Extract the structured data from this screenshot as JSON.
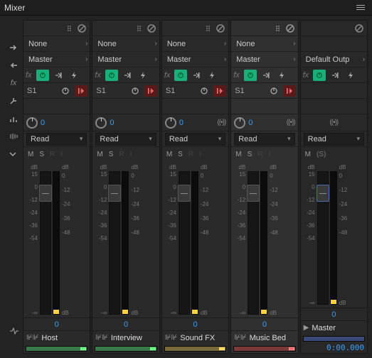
{
  "panel": {
    "title": "Mixer"
  },
  "io": {
    "input_label": "None",
    "output_label": "Master",
    "master_output_label": "Default Outp"
  },
  "fx": {
    "label": "fx"
  },
  "send": {
    "name": "S1"
  },
  "pan": {
    "value": "0"
  },
  "automation": {
    "mode": "Read"
  },
  "msri": {
    "m": "M",
    "s": "S",
    "r": "R",
    "i": "I",
    "s_master": "(S)"
  },
  "scale_left": {
    "top": "dB",
    "v15": "15",
    "v0": "0",
    "vn12": "-12",
    "vn24": "-24",
    "vn36": "-36",
    "vn54": "-54",
    "bottom": "-∞"
  },
  "scale_right": {
    "top": "dB",
    "v0": "0",
    "vn12": "-12",
    "vn24": "-24",
    "vn36": "-36",
    "vn48": "-48",
    "bottom": "dB"
  },
  "volume": {
    "value": "0"
  },
  "tracks": [
    {
      "name": "Host",
      "color": "#3a7a4a",
      "sq": "#4aff6a"
    },
    {
      "name": "Interview",
      "color": "#3a7a4a",
      "sq": "#4aff6a"
    },
    {
      "name": "Sound FX",
      "color": "#7a6a3a",
      "sq": "#ffd23f"
    },
    {
      "name": "Music Bed",
      "color": "#7a3a3a",
      "sq": "#ff5a5a"
    }
  ],
  "master": {
    "name": "Master",
    "color": "#3a4a7a"
  },
  "timecode": "0:00.000",
  "icons": {
    "stereo": "((•))"
  }
}
